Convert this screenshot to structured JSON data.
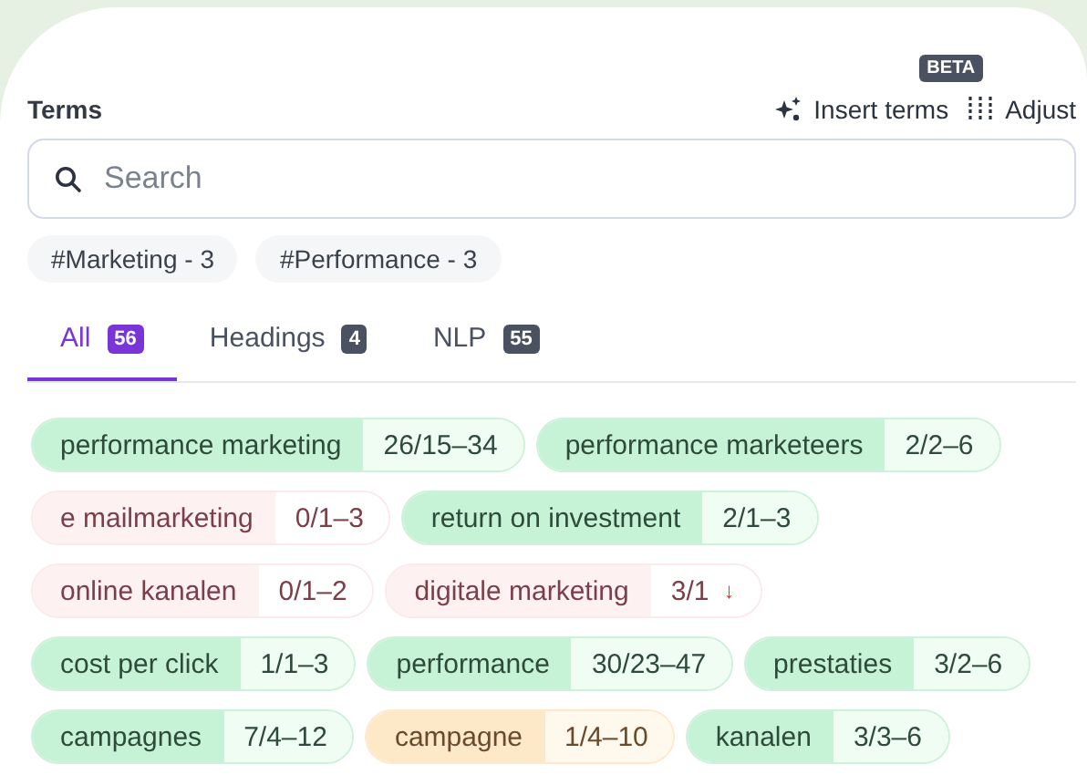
{
  "header": {
    "title": "Terms",
    "insert_button": {
      "label": "Insert terms",
      "badge": "BETA"
    },
    "adjust_button": {
      "label": "Adjust"
    }
  },
  "search": {
    "placeholder": "Search"
  },
  "filters": [
    {
      "label": "#Marketing - 3"
    },
    {
      "label": "#Performance - 3"
    }
  ],
  "tabs": [
    {
      "label": "All",
      "count": "56",
      "selected": true
    },
    {
      "label": "Headings",
      "count": "4",
      "selected": false
    },
    {
      "label": "NLP",
      "count": "55",
      "selected": false
    }
  ],
  "terms": [
    {
      "term": "performance marketing",
      "usage": "26/15–34",
      "kind": "ok"
    },
    {
      "term": "performance marketeers",
      "usage": "2/2–6",
      "kind": "ok"
    },
    {
      "term": "e mailmarketing",
      "usage": "0/1–3",
      "kind": "missing"
    },
    {
      "term": "return on investment",
      "usage": "2/1–3",
      "kind": "ok"
    },
    {
      "term": "online kanalen",
      "usage": "0/1–2",
      "kind": "missing"
    },
    {
      "term": "digitale marketing",
      "usage": "3/1",
      "arrow": "↓",
      "kind": "missing"
    },
    {
      "term": "cost per click",
      "usage": "1/1–3",
      "kind": "ok"
    },
    {
      "term": "performance",
      "usage": "30/23–47",
      "kind": "ok"
    },
    {
      "term": "prestaties",
      "usage": "3/2–6",
      "kind": "ok"
    },
    {
      "term": "campagnes",
      "usage": "7/4–12",
      "kind": "ok"
    },
    {
      "term": "campagne",
      "usage": "1/4–10",
      "kind": "low"
    },
    {
      "term": "kanalen",
      "usage": "3/3–6",
      "kind": "ok"
    }
  ]
}
